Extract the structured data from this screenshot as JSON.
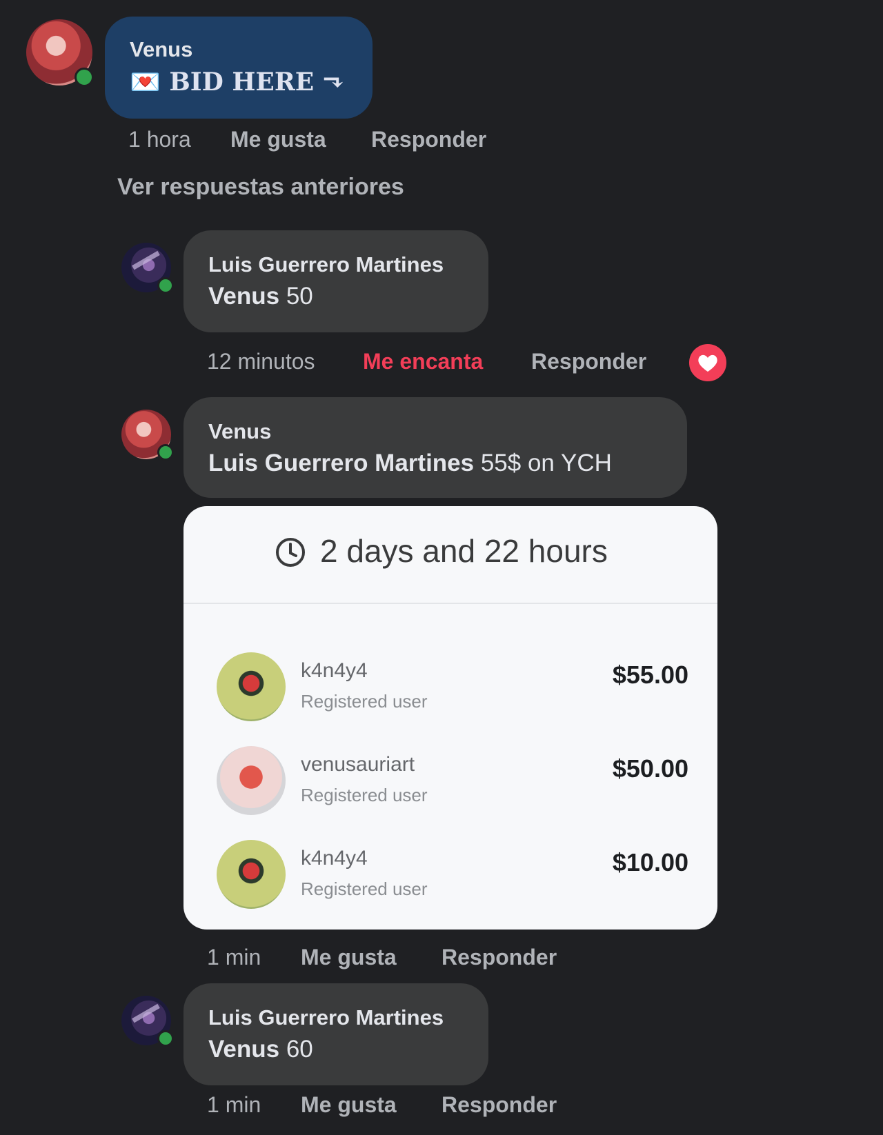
{
  "comments": [
    {
      "author": "Venus",
      "body_emoji": "💌",
      "body_text": "𝐁𝐈𝐃 𝐇𝐄𝐑𝐄 ⬎",
      "time": "1 hora",
      "like": "Me gusta",
      "reply": "Responder"
    },
    {
      "author": "Luis Guerrero Martines",
      "mention": "Venus",
      "body_text": "50",
      "time": "12 minutos",
      "like": "Me encanta",
      "reply": "Responder",
      "reaction": "love"
    },
    {
      "author": "Venus",
      "mention": "Luis Guerrero Martines",
      "body_text": "55$ on YCH",
      "time": "1 min",
      "like": "Me gusta",
      "reply": "Responder"
    },
    {
      "author": "Luis Guerrero Martines",
      "mention": "Venus",
      "body_text": "60",
      "time": "1 min",
      "like": "Me gusta",
      "reply": "Responder"
    }
  ],
  "view_previous": "Ver respuestas anteriores",
  "auction_card": {
    "timer": "2 days and 22 hours",
    "bids": [
      {
        "name": "k4n4y4",
        "role": "Registered user",
        "amount": "$55.00"
      },
      {
        "name": "venusauriart",
        "role": "Registered user",
        "amount": "$50.00"
      },
      {
        "name": "k4n4y4",
        "role": "Registered user",
        "amount": "$10.00"
      }
    ]
  },
  "colors": {
    "background": "#1f2023",
    "bubble": "#3a3b3c",
    "bubble_highlight": "#1e3f66",
    "love": "#f33e58",
    "online": "#31a24c"
  },
  "icons": {
    "online": "online-indicator",
    "love": "heart-icon",
    "clock": "clock-icon"
  }
}
